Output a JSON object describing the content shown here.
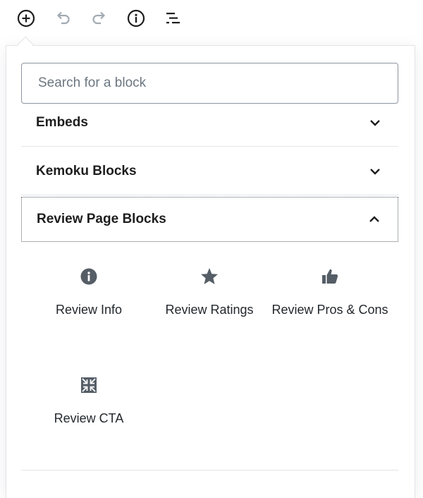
{
  "toolbar": {
    "icons": [
      "add-block-icon",
      "undo-icon",
      "redo-icon",
      "info-icon",
      "list-view-icon"
    ]
  },
  "search": {
    "placeholder": "Search for a block"
  },
  "sections": [
    {
      "title": "Embeds",
      "state": "collapsed"
    },
    {
      "title": "Kemoku Blocks",
      "state": "collapsed"
    },
    {
      "title": "Review Page Blocks",
      "state": "expanded"
    }
  ],
  "blocks": [
    {
      "label": "Review Info",
      "icon": "info-icon"
    },
    {
      "label": "Review Ratings",
      "icon": "star-icon"
    },
    {
      "label": "Review Pros & Cons",
      "icon": "thumbs-up-icon"
    },
    {
      "label": "Review CTA",
      "icon": "shrink-arrows-icon"
    }
  ],
  "colors": {
    "icon": "#555d66",
    "icon_disabled": "#a2aab2",
    "border": "#e2e4e7"
  }
}
